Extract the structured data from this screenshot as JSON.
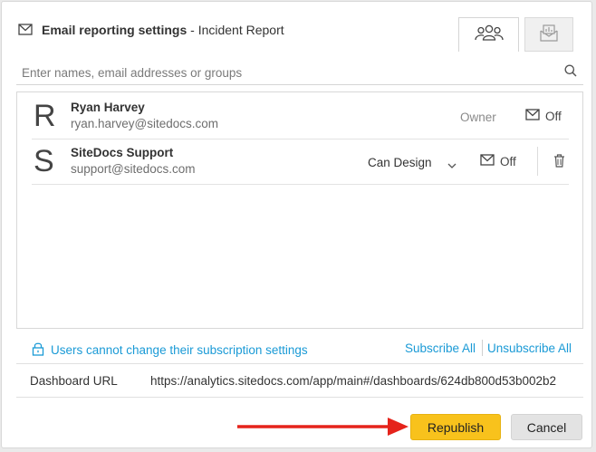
{
  "dialog": {
    "title": "Email reporting settings",
    "subtitle": "- Incident Report",
    "tabs": [
      {
        "icon": "people-icon",
        "active": true
      },
      {
        "icon": "dashboard-icon",
        "active": false
      }
    ]
  },
  "search": {
    "placeholder": "Enter names, email addresses or groups",
    "value": ""
  },
  "users": [
    {
      "initial": "R",
      "name": "Ryan Harvey",
      "email": "ryan.harvey@sitedocs.com",
      "role": "Owner",
      "email_status": "Off"
    },
    {
      "initial": "S",
      "name": "SiteDocs Support",
      "email": "support@sitedocs.com",
      "role": "Can Design",
      "email_status": "Off"
    }
  ],
  "footer": {
    "lock_note": "Users cannot change their subscription settings",
    "subscribe_all": "Subscribe All",
    "unsubscribe_all": "Unsubscribe All"
  },
  "url": {
    "label": "Dashboard URL",
    "value": "https://analytics.sitedocs.com/app/main#/dashboards/624db800d53b002b2"
  },
  "buttons": {
    "republish": "Republish",
    "cancel": "Cancel"
  },
  "colors": {
    "accent_link": "#1a9ad6",
    "primary_button": "#f8c21c",
    "annotation_arrow": "#e5231b"
  }
}
